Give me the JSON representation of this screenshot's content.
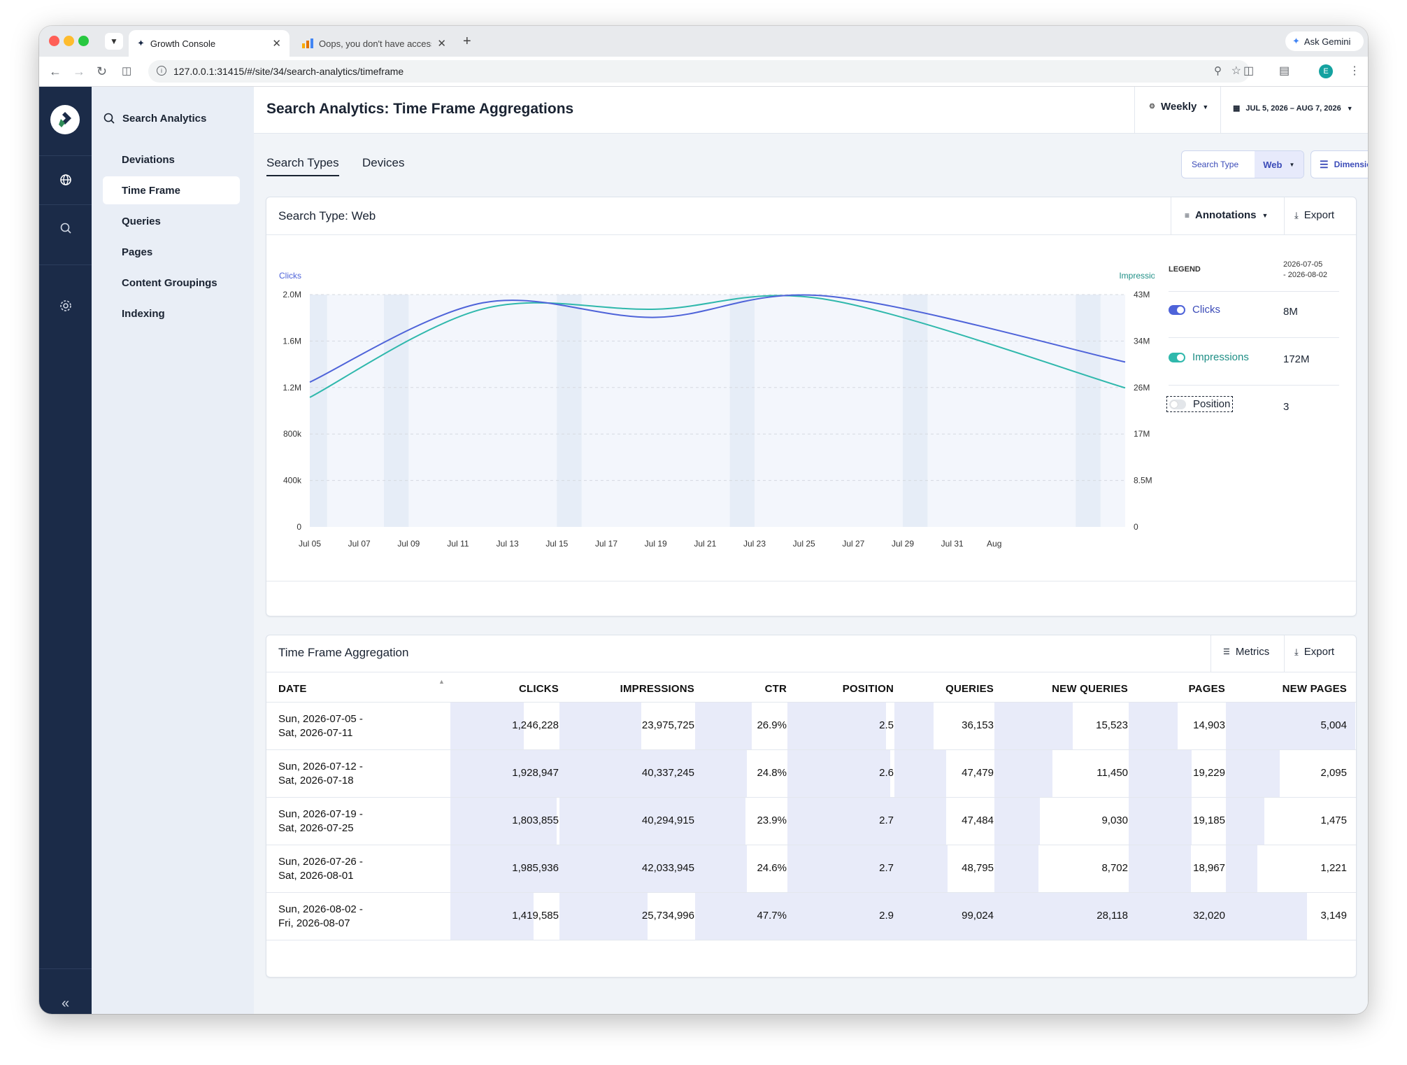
{
  "browser": {
    "tabs": [
      {
        "title": "Growth Console"
      },
      {
        "title": "Oops, you don't have access"
      }
    ],
    "url": "127.0.0.1:31415/#/site/34/search-analytics/timeframe",
    "ask_gemini": "Ask Gemini",
    "profile_initial": "E"
  },
  "sidebar": {
    "section_title": "Search Analytics",
    "items": [
      {
        "label": "Deviations"
      },
      {
        "label": "Time Frame"
      },
      {
        "label": "Queries"
      },
      {
        "label": "Pages"
      },
      {
        "label": "Content Groupings"
      },
      {
        "label": "Indexing"
      }
    ]
  },
  "header": {
    "title": "Search Analytics: Time Frame Aggregations",
    "granularity": "Weekly",
    "date_range": "JUL 5, 2026 – AUG 7, 2026"
  },
  "tabs": [
    {
      "label": "Search Types"
    },
    {
      "label": "Devices"
    }
  ],
  "filters": {
    "search_type_label": "Search Type",
    "search_type_value": "Web",
    "dimensions_label": "Dimensions"
  },
  "chart_card": {
    "title": "Search Type: Web",
    "annotations_label": "Annotations",
    "export_label": "Export"
  },
  "legend": {
    "heading": "LEGEND",
    "date_range": "2026-07-05\n- 2026-08-02",
    "items": [
      {
        "label": "Clicks",
        "value": "8M",
        "color": "#4e63d9",
        "enabled": true
      },
      {
        "label": "Impressions",
        "value": "172M",
        "color": "#2fb8ac",
        "enabled": true
      },
      {
        "label": "Position",
        "value": "3",
        "color": "#9aa3ad",
        "enabled": false
      }
    ]
  },
  "chart_data": {
    "type": "line",
    "title": "",
    "x_ticks": [
      "Jul 05",
      "Jul 07",
      "Jul 09",
      "Jul 11",
      "Jul 13",
      "Jul 15",
      "Jul 17",
      "Jul 19",
      "Jul 21",
      "Jul 23",
      "Jul 25",
      "Jul 27",
      "Jul 29",
      "Jul 31",
      "Aug"
    ],
    "x": [
      "2026-07-05",
      "2026-07-12",
      "2026-07-19",
      "2026-07-26",
      "2026-08-02"
    ],
    "y_left": {
      "label": "Clicks",
      "ticks": [
        "0",
        "400k",
        "800k",
        "1.2M",
        "1.6M",
        "2.0M"
      ],
      "max": 2000000
    },
    "y_right": {
      "label": "Impressions",
      "ticks": [
        "0",
        "8.5M",
        "17M",
        "26M",
        "34M",
        "43M"
      ],
      "max": 43000000
    },
    "series": [
      {
        "name": "Clicks",
        "axis": "left",
        "color": "#4e63d9",
        "values": [
          1246228,
          1928947,
          1803855,
          1985936,
          1419585
        ]
      },
      {
        "name": "Impressions",
        "axis": "right",
        "color": "#2fb8ac",
        "values": [
          23975725,
          40337245,
          40294915,
          42033945,
          25734996
        ]
      }
    ],
    "grid": true
  },
  "table_card": {
    "title": "Time Frame Aggregation",
    "metrics_label": "Metrics",
    "export_label": "Export",
    "columns": [
      "DATE",
      "CLICKS",
      "IMPRESSIONS",
      "CTR",
      "POSITION",
      "QUERIES",
      "NEW QUERIES",
      "PAGES",
      "NEW PAGES"
    ],
    "rows": [
      {
        "date1": "Sun, 2026-07-05 -",
        "date2": "Sat, 2026-07-11",
        "clicks": "1,246,228",
        "impressions": "23,975,725",
        "ctr": "26.9%",
        "position": "2.5",
        "queries": "36,153",
        "new_queries": "15,523",
        "pages": "14,903",
        "new_pages": "5,004"
      },
      {
        "date1": "Sun, 2026-07-12 -",
        "date2": "Sat, 2026-07-18",
        "clicks": "1,928,947",
        "impressions": "40,337,245",
        "ctr": "24.8%",
        "position": "2.6",
        "queries": "47,479",
        "new_queries": "11,450",
        "pages": "19,229",
        "new_pages": "2,095"
      },
      {
        "date1": "Sun, 2026-07-19 -",
        "date2": "Sat, 2026-07-25",
        "clicks": "1,803,855",
        "impressions": "40,294,915",
        "ctr": "23.9%",
        "position": "2.7",
        "queries": "47,484",
        "new_queries": "9,030",
        "pages": "19,185",
        "new_pages": "1,475"
      },
      {
        "date1": "Sun, 2026-07-26 -",
        "date2": "Sat, 2026-08-01",
        "clicks": "1,985,936",
        "impressions": "42,033,945",
        "ctr": "24.6%",
        "position": "2.7",
        "queries": "48,795",
        "new_queries": "8,702",
        "pages": "18,967",
        "new_pages": "1,221"
      },
      {
        "date1": "Sun, 2026-08-02 -",
        "date2": "Fri, 2026-08-07",
        "clicks": "1,419,585",
        "impressions": "25,734,996",
        "ctr": "47.7%",
        "position": "2.9",
        "queries": "99,024",
        "new_queries": "28,118",
        "pages": "32,020",
        "new_pages": "3,149"
      }
    ]
  },
  "colors": {
    "rail": "#1b2b48",
    "accent": "#4e63d9",
    "teal": "#2fb8ac",
    "bar_fill": "#e8ebf9"
  }
}
